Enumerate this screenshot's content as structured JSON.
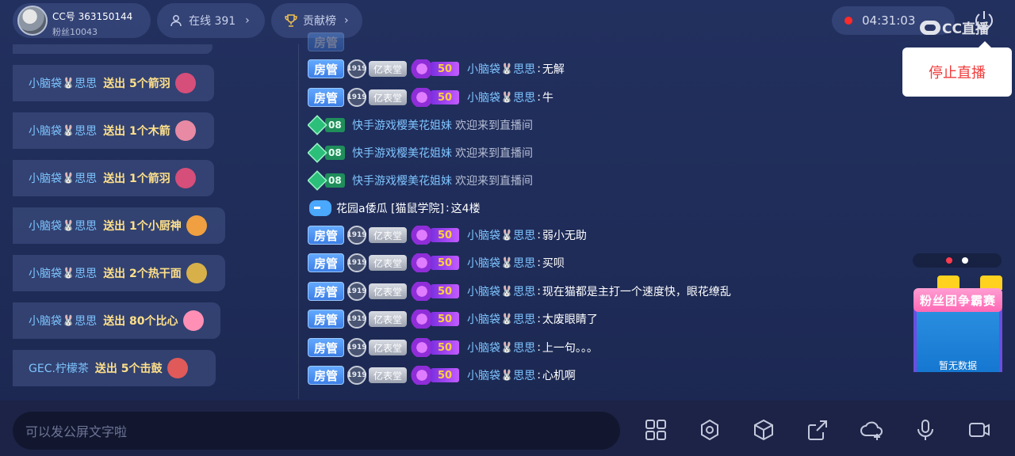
{
  "header": {
    "uid": "CC号 363150144",
    "fans": "粉丝10043",
    "online": "在线 391",
    "rank": "贡献榜",
    "timer": "04:31:03",
    "logo": "CC直播",
    "stop_live": "停止直播",
    "colors": {
      "record": "#ff2a2a",
      "stop_text": "#f23b3b"
    }
  },
  "gifts": [
    {
      "user": "小脑袋",
      "user2": "思思",
      "action": "送出 5个箭羽",
      "icon": "arrow-feather-icon",
      "color": "#d64e7a"
    },
    {
      "user": "小脑袋",
      "user2": "思思",
      "action": "送出 1个木箭",
      "icon": "wood-arrow-icon",
      "color": "#e88aa3"
    },
    {
      "user": "小脑袋",
      "user2": "思思",
      "action": "送出 1个箭羽",
      "icon": "arrow-feather-icon",
      "color": "#d64e7a"
    },
    {
      "user": "小脑袋",
      "user2": "思思",
      "action": "送出 1个小厨神",
      "icon": "chef-icon",
      "color": "#f0a040"
    },
    {
      "user": "小脑袋",
      "user2": "思思",
      "action": "送出 2个热干面",
      "icon": "noodle-icon",
      "color": "#d8b04a"
    },
    {
      "user": "小脑袋",
      "user2": "思思",
      "action": "送出 80个比心",
      "icon": "heart-hand-icon",
      "color": "#ff8fb5"
    },
    {
      "user": "GEC.柠檬茶",
      "user2": "",
      "action": "送出 5个击鼓",
      "icon": "drum-icon",
      "color": "#e05a5a"
    }
  ],
  "chat": {
    "badges": {
      "guan": "房管",
      "shield": "1919",
      "yi": "亿表堂",
      "level": "50",
      "green": "08"
    },
    "messages": [
      {
        "type": "admin",
        "nick": "小脑袋",
        "nick2": "思思",
        "text": "无解"
      },
      {
        "type": "admin",
        "nick": "小脑袋",
        "nick2": "思思",
        "text": "牛"
      },
      {
        "type": "welcome",
        "nick": "快手游戏樱美花姐妹",
        "text": "欢迎来到直播间"
      },
      {
        "type": "welcome",
        "nick": "快手游戏樱美花姐妹",
        "text": "欢迎来到直播间"
      },
      {
        "type": "welcome",
        "nick": "快手游戏樱美花姐妹",
        "text": "欢迎来到直播间"
      },
      {
        "type": "game",
        "nick": "花园a倭瓜 [猫鼠学院]",
        "text": "这4楼"
      },
      {
        "type": "admin",
        "nick": "小脑袋",
        "nick2": "思思",
        "text": "弱小无助"
      },
      {
        "type": "admin",
        "nick": "小脑袋",
        "nick2": "思思",
        "text": "买呗"
      },
      {
        "type": "admin",
        "nick": "小脑袋",
        "nick2": "思思",
        "text": "现在猫都是主打一个速度快，眼花缭乱"
      },
      {
        "type": "admin",
        "nick": "小脑袋",
        "nick2": "思思",
        "text": "太废眼睛了"
      },
      {
        "type": "admin",
        "nick": "小脑袋",
        "nick2": "思思",
        "text": "上一句。。。"
      },
      {
        "type": "admin",
        "nick": "小脑袋",
        "nick2": "思思",
        "text": "心机啊"
      }
    ]
  },
  "widget": {
    "banner": "粉丝团争霸赛",
    "empty": "暂无数据",
    "active_dot": 1
  },
  "bottom": {
    "placeholder": "可以发公屏文字啦",
    "tools": [
      "grid-icon",
      "settings-icon",
      "cube-icon",
      "share-icon",
      "cloud-add-icon",
      "mic-icon",
      "camera-icon"
    ]
  }
}
